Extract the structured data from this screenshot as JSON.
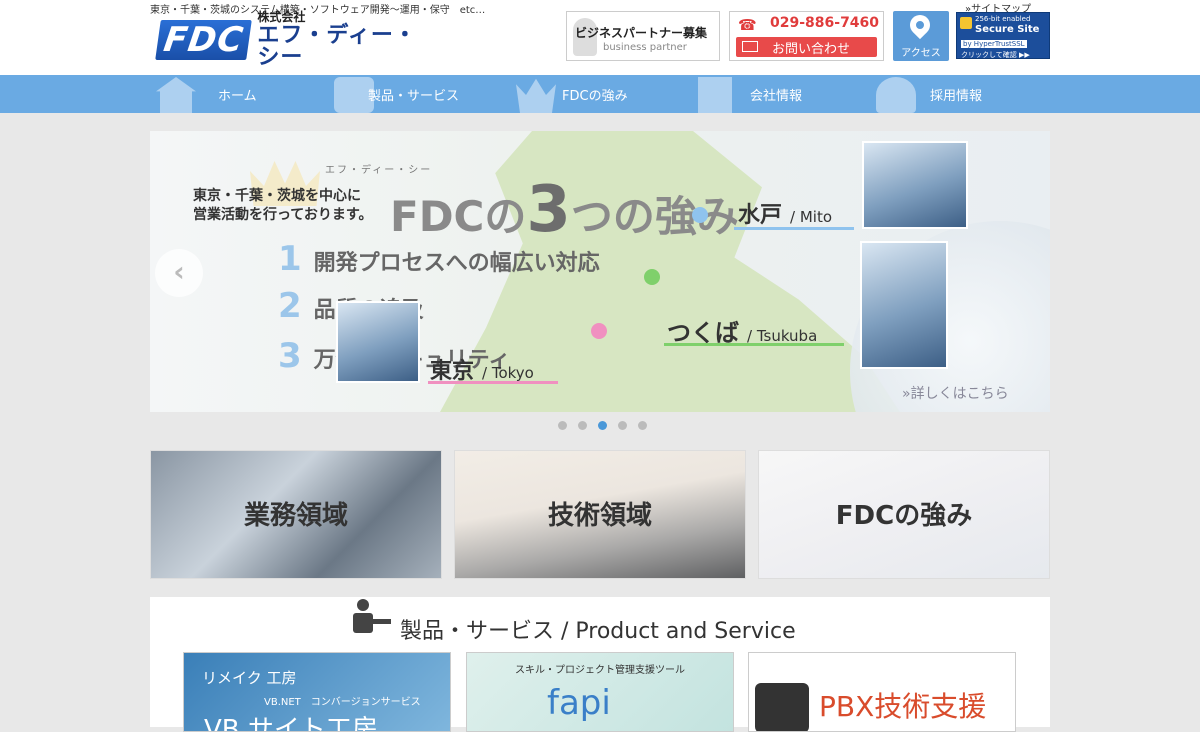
{
  "header": {
    "tagline": "東京・千葉・茨城のシステム構築・ソフトウェア開発〜運用・保守　etc…",
    "logo_mark": "FDC",
    "logo_corp": "株式会社",
    "logo_name": "エフ・ディー・シー",
    "partner_ja": "ビジネスパートナー募集",
    "partner_en": "business partner",
    "tel": "029-886-7460",
    "contact_label": "お問い合わせ",
    "access_label": "アクセス",
    "sitemap": "»サイトマップ",
    "ssl": {
      "line1": "256-bit enabled",
      "line2": "Secure Site",
      "line3": "by HyperTrustSSL",
      "line4": "クリックして確認 ▶▶"
    }
  },
  "nav": {
    "home": "ホーム",
    "products": "製品・サービス",
    "strengths": "FDCの強み",
    "company": "会社情報",
    "recruit": "採用情報"
  },
  "slider": {
    "small_label": "エフ・ディー・シー",
    "title_prefix": "FDCの",
    "title_num": "3",
    "title_suffix": "つの強み",
    "desc_line1": "東京・千葉・茨城を中心に",
    "desc_line2": "営業活動を行っております。",
    "points": [
      {
        "num": "1",
        "text": "開発プロセスへの幅広い対応"
      },
      {
        "num": "2",
        "text": "品質の追及"
      },
      {
        "num": "3",
        "text": "万全のセキュリティ"
      }
    ],
    "cities": {
      "mito": {
        "ja": "水戸",
        "en": "/ Mito"
      },
      "tsukuba": {
        "ja": "つくば",
        "en": "/ Tsukuba"
      },
      "tokyo": {
        "ja": "東京",
        "en": "/ Tokyo"
      }
    },
    "more": "»詳しくはこちら",
    "prev": "‹",
    "active_dot": 3,
    "dot_count": 5
  },
  "tiles": {
    "business": "業務領域",
    "technology": "技術領域",
    "strengths": "FDCの強み"
  },
  "products": {
    "title": "製品・サービス / Product and Service",
    "cards": [
      {
        "line1": "リメイク 工房",
        "line2": "VB.NET　コンバージョンサービス",
        "line3": "VB サイト工房"
      },
      {
        "line1": "スキル・プロジェクト管理支援ツール",
        "line2": "fapi"
      },
      {
        "line1": "PBX技術支援"
      }
    ]
  },
  "colors": {
    "nav_bg": "#6aaae3",
    "accent_red": "#e84a4a",
    "access_blue": "#5b9bd8",
    "dot_active": "#4a98d8"
  }
}
